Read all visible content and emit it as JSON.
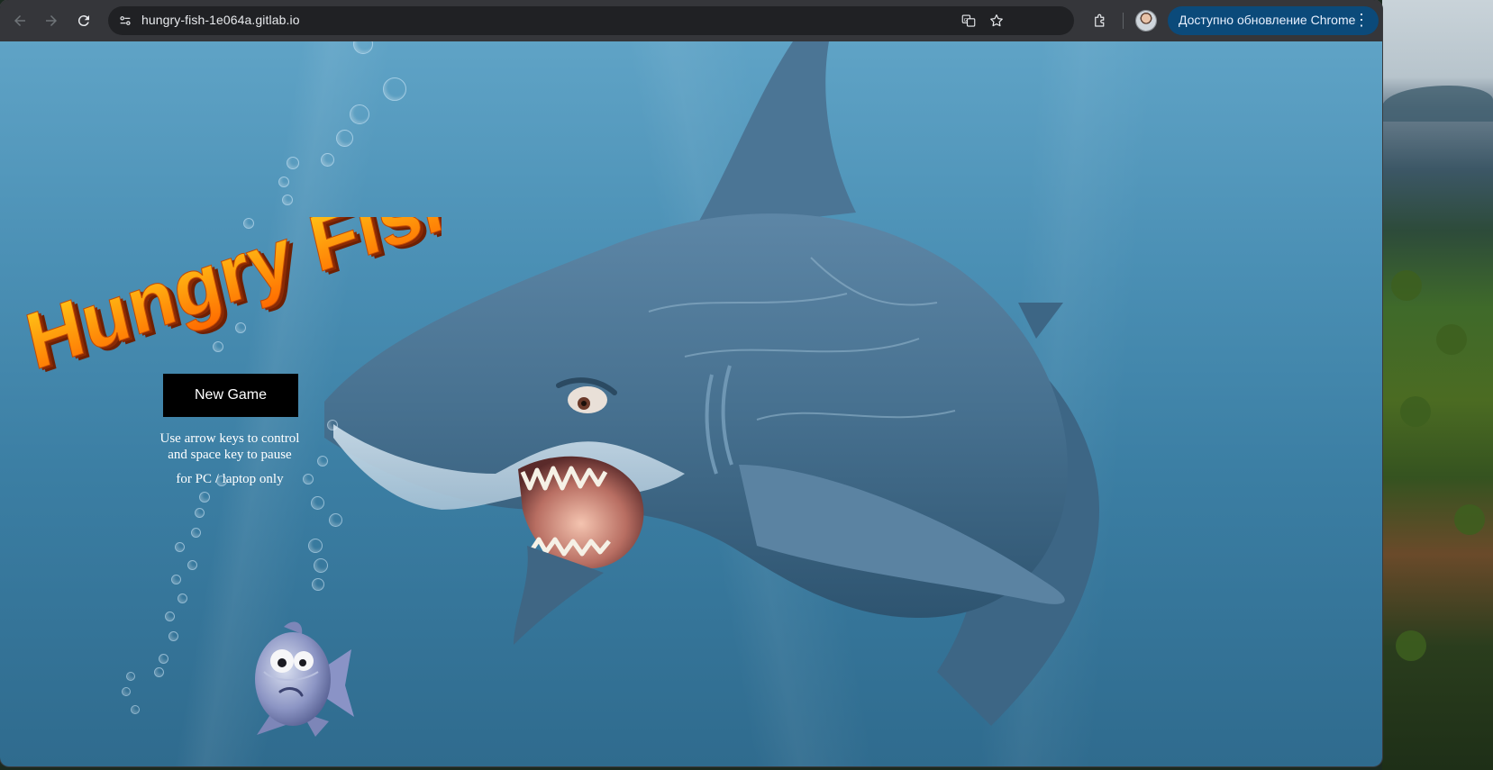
{
  "browser": {
    "url": "hungry-fish-1e064a.gitlab.io",
    "update_label": "Доступно обновление Chrome",
    "icons": [
      "back-arrow-icon",
      "forward-arrow-icon",
      "reload-icon",
      "site-settings-icon",
      "translate-icon",
      "bookmark-star-icon",
      "extensions-icon",
      "profile-avatar",
      "more-vert-icon"
    ]
  },
  "game": {
    "title": "Hungry Fish",
    "new_game_label": "New Game",
    "instruction_line1": "Use arrow keys to control",
    "instruction_line2": "and space key to pause",
    "platform_note": "for PC / laptop only"
  },
  "colors": {
    "title_fill_top": "#ffd21a",
    "title_fill_bottom": "#ff6a00",
    "title_extrude": "#8a2a05",
    "water_top": "#5fa3c6",
    "water_bottom": "#2f6b8e",
    "button_bg": "#000000",
    "update_button_bg": "#0b4a7a"
  }
}
